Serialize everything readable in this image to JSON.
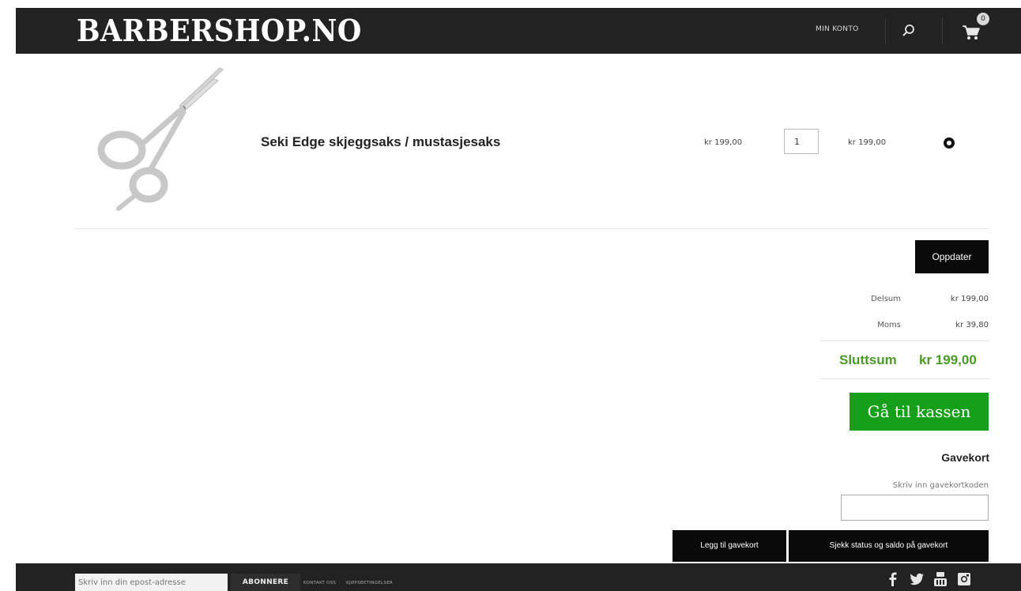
{
  "header": {
    "logo": "BARBERSHOP.NO",
    "account_link": "MIN KONTO",
    "search_icon": "search-icon",
    "cart_icon": "cart-icon",
    "cart_count": "0"
  },
  "cart": {
    "items": [
      {
        "name": "Seki Edge skjeggsaks / mustasjesaks",
        "unit_price": "kr 199,00",
        "quantity": "1",
        "line_total": "kr 199,00",
        "image_icon": "scissors-image",
        "remove_icon": "remove-icon"
      }
    ],
    "update_label": "Oppdater"
  },
  "summary": {
    "subtotal_label": "Delsum",
    "subtotal_value": "kr 199,00",
    "vat_label": "Moms",
    "vat_value": "kr 39,80",
    "total_label": "Sluttsum",
    "total_value": "kr 199,00",
    "checkout_label": "Gå til kassen"
  },
  "gift_card": {
    "heading": "Gavekort",
    "input_label": "Skriv inn gavekortkoden",
    "input_value": "",
    "add_label": "Legg til gavekort",
    "check_label": "Sjekk status og saldo på gavekort"
  },
  "footer": {
    "newsletter_placeholder": "Skriv inn din epost-adresse",
    "subscribe_label": "ABONNERE",
    "links": [
      "KONTAKT OSS",
      "KJØPSBETINGELSER"
    ],
    "social_icons": [
      "facebook-icon",
      "twitter-icon",
      "youtube-icon",
      "instagram-icon"
    ]
  },
  "colors": {
    "bar_background": "#222222",
    "total_green": "#4a9a28",
    "checkout_green": "#16a01a",
    "button_black": "#0a0a0a"
  }
}
